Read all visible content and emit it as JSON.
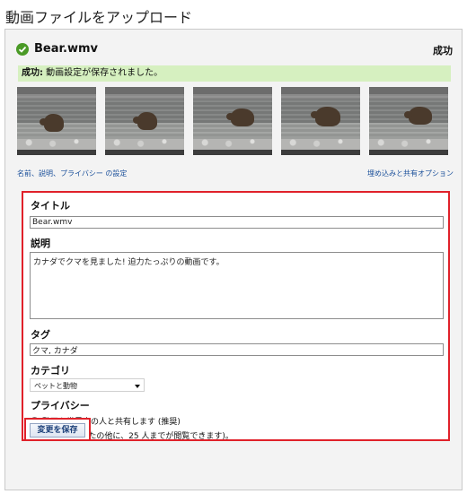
{
  "page": {
    "title": "動画ファイルをアップロード"
  },
  "upload": {
    "file_name": "Bear.wmv",
    "status": "成功",
    "banner_prefix": "成功:",
    "banner_message": " 動画設定が保存されました。"
  },
  "thumbnails": [
    {
      "bear": true
    },
    {
      "bear": true
    },
    {
      "bear": true
    },
    {
      "bear": true
    },
    {
      "bear": true
    }
  ],
  "tabs": {
    "left": "名前、説明、プライバシー の設定",
    "right": "埋め込みと共有オプション"
  },
  "form": {
    "title_label": "タイトル",
    "title_value": "Bear.wmv",
    "description_label": "説明",
    "description_value": "カナダでクマを見ました! 迫力たっぷりの動画です。",
    "tags_label": "タグ",
    "tags_value": "クマ, カナダ",
    "category_label": "カテゴリ",
    "category_value": "ペットと動物",
    "privacy_label": "プライバシー",
    "privacy_public": "動画を世界中の人と共有します (推奨)",
    "privacy_private": "非公開 (あなたの他に、25 人までが閲覧できます)。",
    "privacy_selected": "public"
  },
  "actions": {
    "save_label": "変更を保存"
  },
  "colors": {
    "highlight": "#e0212a",
    "banner": "#d6f0c0",
    "link": "#1a4f9a",
    "success_icon": "#4a9a26"
  }
}
